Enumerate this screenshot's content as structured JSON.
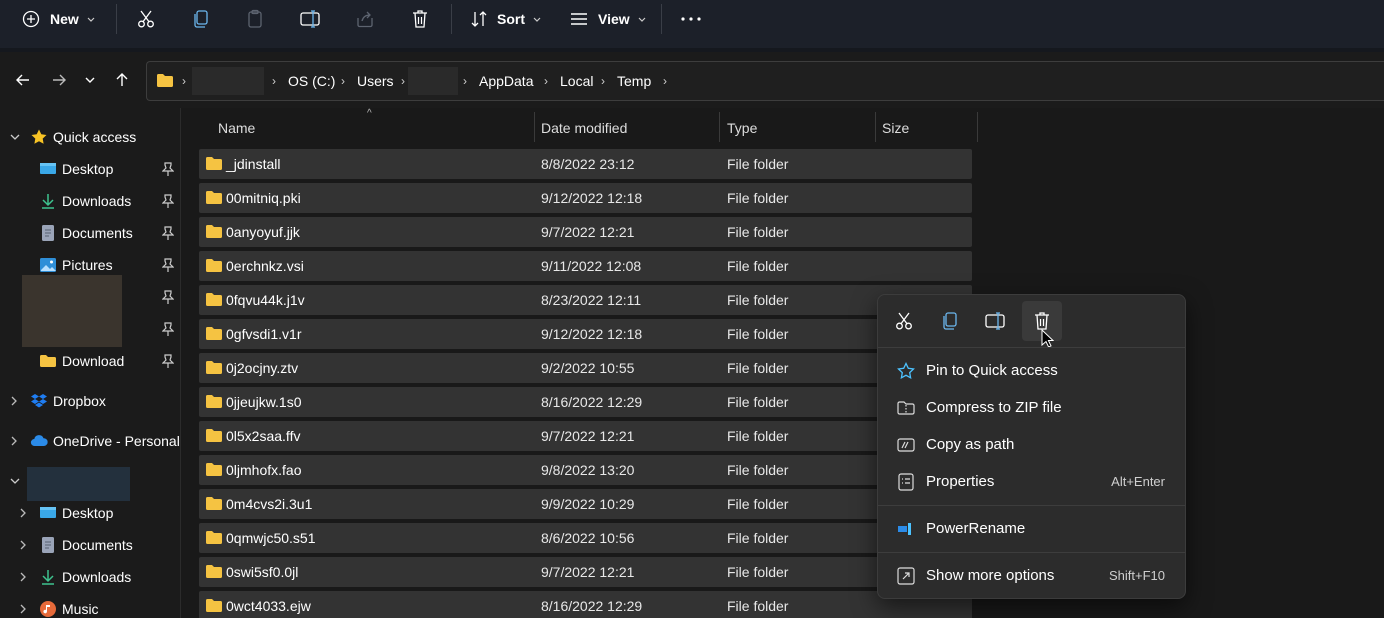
{
  "toolbar": {
    "new_label": "New",
    "sort_label": "Sort",
    "view_label": "View"
  },
  "address": {
    "crumbs": [
      "OS (C:)",
      "Users",
      "AppData",
      "Local",
      "Temp"
    ]
  },
  "sidebar": {
    "quick_access": "Quick access",
    "pinned": [
      "Desktop",
      "Downloads",
      "Documents",
      "Pictures"
    ],
    "download": "Download",
    "dropbox": "Dropbox",
    "onedrive": "OneDrive - Personal",
    "pc_items": [
      "Desktop",
      "Documents",
      "Downloads",
      "Music"
    ]
  },
  "columns": {
    "name": "Name",
    "date": "Date modified",
    "type": "Type",
    "size": "Size"
  },
  "files": [
    {
      "name": "_jdinstall",
      "date": "8/8/2022 23:12",
      "type": "File folder"
    },
    {
      "name": "00mitniq.pki",
      "date": "9/12/2022 12:18",
      "type": "File folder"
    },
    {
      "name": "0anyoyuf.jjk",
      "date": "9/7/2022 12:21",
      "type": "File folder"
    },
    {
      "name": "0erchnkz.vsi",
      "date": "9/11/2022 12:08",
      "type": "File folder"
    },
    {
      "name": "0fqvu44k.j1v",
      "date": "8/23/2022 12:11",
      "type": "File folder"
    },
    {
      "name": "0gfvsdi1.v1r",
      "date": "9/12/2022 12:18",
      "type": "File folder"
    },
    {
      "name": "0j2ocjny.ztv",
      "date": "9/2/2022 10:55",
      "type": "File folder"
    },
    {
      "name": "0jjeujkw.1s0",
      "date": "8/16/2022 12:29",
      "type": "File folder"
    },
    {
      "name": "0l5x2saa.ffv",
      "date": "9/7/2022 12:21",
      "type": "File folder"
    },
    {
      "name": "0ljmhofx.fao",
      "date": "9/8/2022 13:20",
      "type": "File folder"
    },
    {
      "name": "0m4cvs2i.3u1",
      "date": "9/9/2022 10:29",
      "type": "File folder"
    },
    {
      "name": "0qmwjc50.s51",
      "date": "8/6/2022 10:56",
      "type": "File folder"
    },
    {
      "name": "0swi5sf0.0jl",
      "date": "9/7/2022 12:21",
      "type": "File folder"
    },
    {
      "name": "0wct4033.ejw",
      "date": "8/16/2022 12:29",
      "type": "File folder"
    }
  ],
  "context_menu": {
    "pin": "Pin to Quick access",
    "compress": "Compress to ZIP file",
    "copy_path": "Copy as path",
    "properties": "Properties",
    "properties_shortcut": "Alt+Enter",
    "powerrename": "PowerRename",
    "more_options": "Show more options",
    "more_options_shortcut": "Shift+F10"
  },
  "colors": {
    "folder": "#f5c342",
    "accent": "#4cc2ff",
    "star": "#f7c325"
  }
}
